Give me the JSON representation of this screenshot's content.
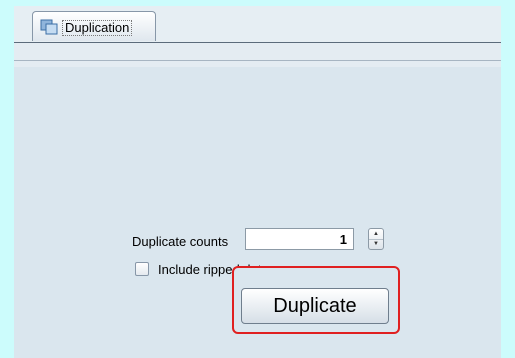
{
  "tabs": [
    {
      "label": "Duplication",
      "icon": "duplicate-icon"
    }
  ],
  "form": {
    "counts_label": "Duplicate counts",
    "counts_value": "1",
    "include_label": "Include ripped data",
    "include_checked": false,
    "duplicate_button": "Duplicate"
  },
  "colors": {
    "background": "#ccfcfc",
    "panel": "#dae6ee",
    "highlight": "#e02020"
  }
}
